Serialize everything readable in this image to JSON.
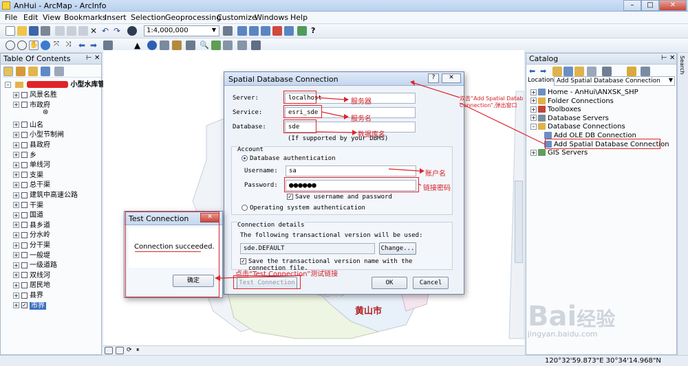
{
  "window": {
    "title": "AnHui - ArcMap - ArcInfo"
  },
  "menu": [
    "File",
    "Edit",
    "View",
    "Bookmarks",
    "Insert",
    "Selection",
    "Geoprocessing",
    "Customize",
    "Windows",
    "Help"
  ],
  "toolbar": {
    "scale": "1:4,000,000"
  },
  "toc": {
    "title": "Table Of Contents",
    "layer_group": "小型水库管理系统",
    "layers": [
      "风景名胜",
      "市政府",
      "⊛",
      "山名",
      "小型节制闸",
      "县政府",
      "乡",
      "单线河",
      "支渠",
      "总干渠",
      "建筑中高速公路",
      "干渠",
      "国道",
      "县乡道",
      "分水岭",
      "分干渠",
      "一般堤",
      "一级道路",
      "双线河",
      "居民地",
      "县界",
      "市界"
    ]
  },
  "catalog": {
    "title": "Catalog",
    "location_label": "Location:",
    "location_value": "Add Spatial Database Connection",
    "tree": [
      {
        "label": "Home - AnHui\\ANXSK_SHP",
        "level": 0
      },
      {
        "label": "Folder Connections",
        "level": 0
      },
      {
        "label": "Toolboxes",
        "level": 0
      },
      {
        "label": "Database Servers",
        "level": 0
      },
      {
        "label": "Database Connections",
        "level": 0
      },
      {
        "label": "Add OLE DB Connection",
        "level": 1
      },
      {
        "label": "Add Spatial Database Connection",
        "level": 1
      },
      {
        "label": "GIS Servers",
        "level": 0
      }
    ],
    "side_tab": "Search"
  },
  "map": {
    "city_label": "黄山市",
    "faded_label": "池州市"
  },
  "sde_dialog": {
    "title": "Spatial Database Connection",
    "help_btn": "?",
    "server_label": "Server:",
    "server_value": "localhost",
    "service_label": "Service:",
    "service_value": "esri_sde",
    "database_label": "Database:",
    "database_value": "sde",
    "database_note": "(If supported by your DBMS)",
    "account_group": "Account",
    "db_auth_label": "Database authentication",
    "username_label": "Username:",
    "username_value": "sa",
    "password_label": "Password:",
    "password_value": "●●●●●●",
    "save_label": "Save username and password",
    "os_auth_label": "Operating system authentication",
    "conn_group": "Connection details",
    "version_text": "The following transactional version will be used:",
    "version_value": "sde.DEFAULT",
    "change_btn": "Change...",
    "save_version_label": "Save the transactional version name with the connection file.",
    "test_btn": "Test Connection",
    "ok_btn": "OK",
    "cancel_btn": "Cancel"
  },
  "test_dialog": {
    "title": "Test Connection",
    "message": "Connection succeeded.",
    "ok_btn": "确定"
  },
  "annotations": {
    "server": "服务器",
    "service": "服务名",
    "database": "数据库名",
    "username": "账户名",
    "password": "链接密码",
    "test": "点击“Test Connection”测试链接",
    "add_conn_1": "双击“Add Spatial Datab",
    "add_conn_2": "Connection”,弹出窗口"
  },
  "status": {
    "coords": "120°32'59.873\"E  30°34'14.968\"N"
  },
  "watermark": {
    "brand": "Bai",
    "brand2": "经验",
    "url": "jingyan.baidu.com"
  },
  "colors": {
    "accent_red": "#e0242a",
    "title_bar": "#c5d6ee"
  }
}
